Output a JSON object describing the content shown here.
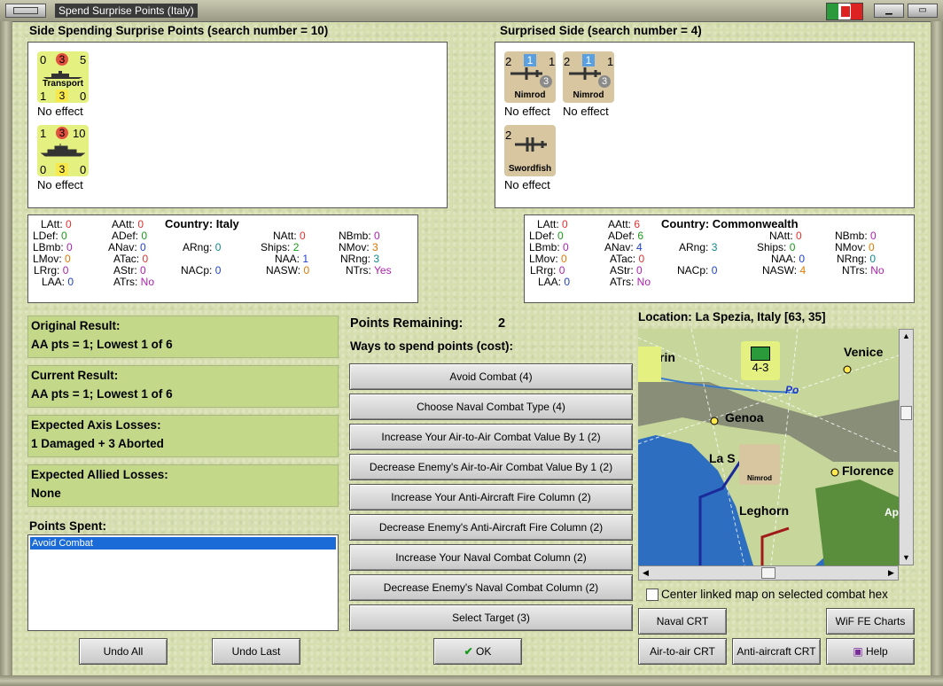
{
  "window": {
    "title": "Spend Surprise Points (Italy)"
  },
  "spending": {
    "heading": "Side Spending Surprise Points (search number = 10)",
    "units": [
      {
        "top_left": "0",
        "top_mid": "3",
        "top_right": "5",
        "name": "Transport",
        "bot_left": "1",
        "bot_mid": "3",
        "bot_right": "0",
        "effect": "No effect"
      },
      {
        "top_left": "1",
        "top_mid": "3",
        "top_right": "10",
        "name": "",
        "bot_left": "0",
        "bot_mid": "3",
        "bot_right": "0",
        "effect": "No effect"
      }
    ]
  },
  "surprised": {
    "heading": "Surprised Side (search number = 4)",
    "units": [
      {
        "left": "2",
        "mid": "1",
        "right": "1",
        "badge": "3",
        "name": "Nimrod",
        "effect": "No effect"
      },
      {
        "left": "2",
        "mid": "1",
        "right": "1",
        "badge": "3",
        "name": "Nimrod",
        "effect": "No effect"
      },
      {
        "left": "2",
        "mid": "",
        "right": "",
        "badge": "",
        "name": "Swordfish",
        "effect": "No effect"
      }
    ]
  },
  "italy_stats": {
    "country_label": "Country: Italy",
    "LAtt": "0",
    "LDef": "0",
    "LBmb": "0",
    "LMov": "0",
    "LRrg": "0",
    "LAA": "0",
    "AAtt": "0",
    "ADef": "0",
    "ANav": "0",
    "ATac": "0",
    "AStr": "0",
    "ATrs": "No",
    "ARng": "0",
    "NACp": "0",
    "NAtt": "0",
    "Ships": "2",
    "NAA": "1",
    "NASW": "0",
    "NBmb": "0",
    "NMov": "3",
    "NRng": "3",
    "NTrs": "Yes"
  },
  "commonwealth_stats": {
    "country_label": "Country: Commonwealth",
    "LAtt": "0",
    "LDef": "0",
    "LBmb": "0",
    "LMov": "0",
    "LRrg": "0",
    "LAA": "0",
    "AAtt": "6",
    "ADef": "6",
    "ANav": "4",
    "ATac": "0",
    "AStr": "0",
    "ATrs": "No",
    "ARng": "3",
    "NACp": "0",
    "NAtt": "0",
    "Ships": "0",
    "NAA": "0",
    "NASW": "4",
    "NBmb": "0",
    "NMov": "0",
    "NRng": "0",
    "NTrs": "No"
  },
  "stat_labels": {
    "LAtt": "LAtt:",
    "LDef": "LDef:",
    "LBmb": "LBmb:",
    "LMov": "LMov:",
    "LRrg": "LRrg:",
    "LAA": "LAA:",
    "AAtt": "AAtt:",
    "ADef": "ADef:",
    "ANav": "ANav:",
    "ATac": "ATac:",
    "AStr": "AStr:",
    "ATrs": "ATrs:",
    "ARng": "ARng:",
    "NACp": "NACp:",
    "NAtt": "NAtt:",
    "Ships": "Ships:",
    "NAA": "NAA:",
    "NASW": "NASW:",
    "NBmb": "NBmb:",
    "NMov": "NMov:",
    "NRng": "NRng:",
    "NTrs": "NTrs:"
  },
  "results": {
    "original_title": "Original Result:",
    "original_value": "AA pts = 1; Lowest 1 of 6",
    "current_title": "Current Result:",
    "current_value": "AA pts = 1; Lowest 1 of 6",
    "axis_title": "Expected Axis Losses:",
    "axis_value": "1 Damaged + 3 Aborted",
    "allied_title": "Expected Allied Losses:",
    "allied_value": "None"
  },
  "points_spent": {
    "label": "Points Spent:",
    "items": [
      "Avoid Combat"
    ]
  },
  "points": {
    "remaining_label": "Points Remaining:",
    "remaining_value": "2",
    "ways_label": "Ways to spend points (cost):",
    "options": [
      "Avoid Combat (4)",
      "Choose Naval Combat Type (4)",
      "Increase Your Air-to-Air Combat Value By 1 (2)",
      "Decrease Enemy's Air-to-Air Combat Value By 1 (2)",
      "Increase Your Anti-Aircraft Fire Column (2)",
      "Decrease Enemy's Anti-Aircraft Fire Column (2)",
      "Increase Your Naval Combat Column (2)",
      "Decrease Enemy's Naval Combat Column (2)",
      "Select Target (3)"
    ]
  },
  "map": {
    "location": "Location: La Spezia, Italy [63, 35]",
    "labels": {
      "venice": "Venice",
      "genoa": "Genoa",
      "laspezia": "La S",
      "florence": "Florence",
      "leghorn": "Leghorn",
      "po": "Po",
      "turin": "rin",
      "ap": "Ap"
    },
    "unit_stack": "4-3",
    "unit_name": "Nimrod"
  },
  "center_map_label": "Center linked map on selected combat hex",
  "buttons": {
    "undo_all": "Undo All",
    "undo_last": "Undo Last",
    "ok": "OK",
    "naval_crt": "Naval CRT",
    "wif_charts": "WiF FE Charts",
    "air_crt": "Air-to-air CRT",
    "aa_crt": "Anti-aircraft CRT",
    "help": "Help"
  }
}
